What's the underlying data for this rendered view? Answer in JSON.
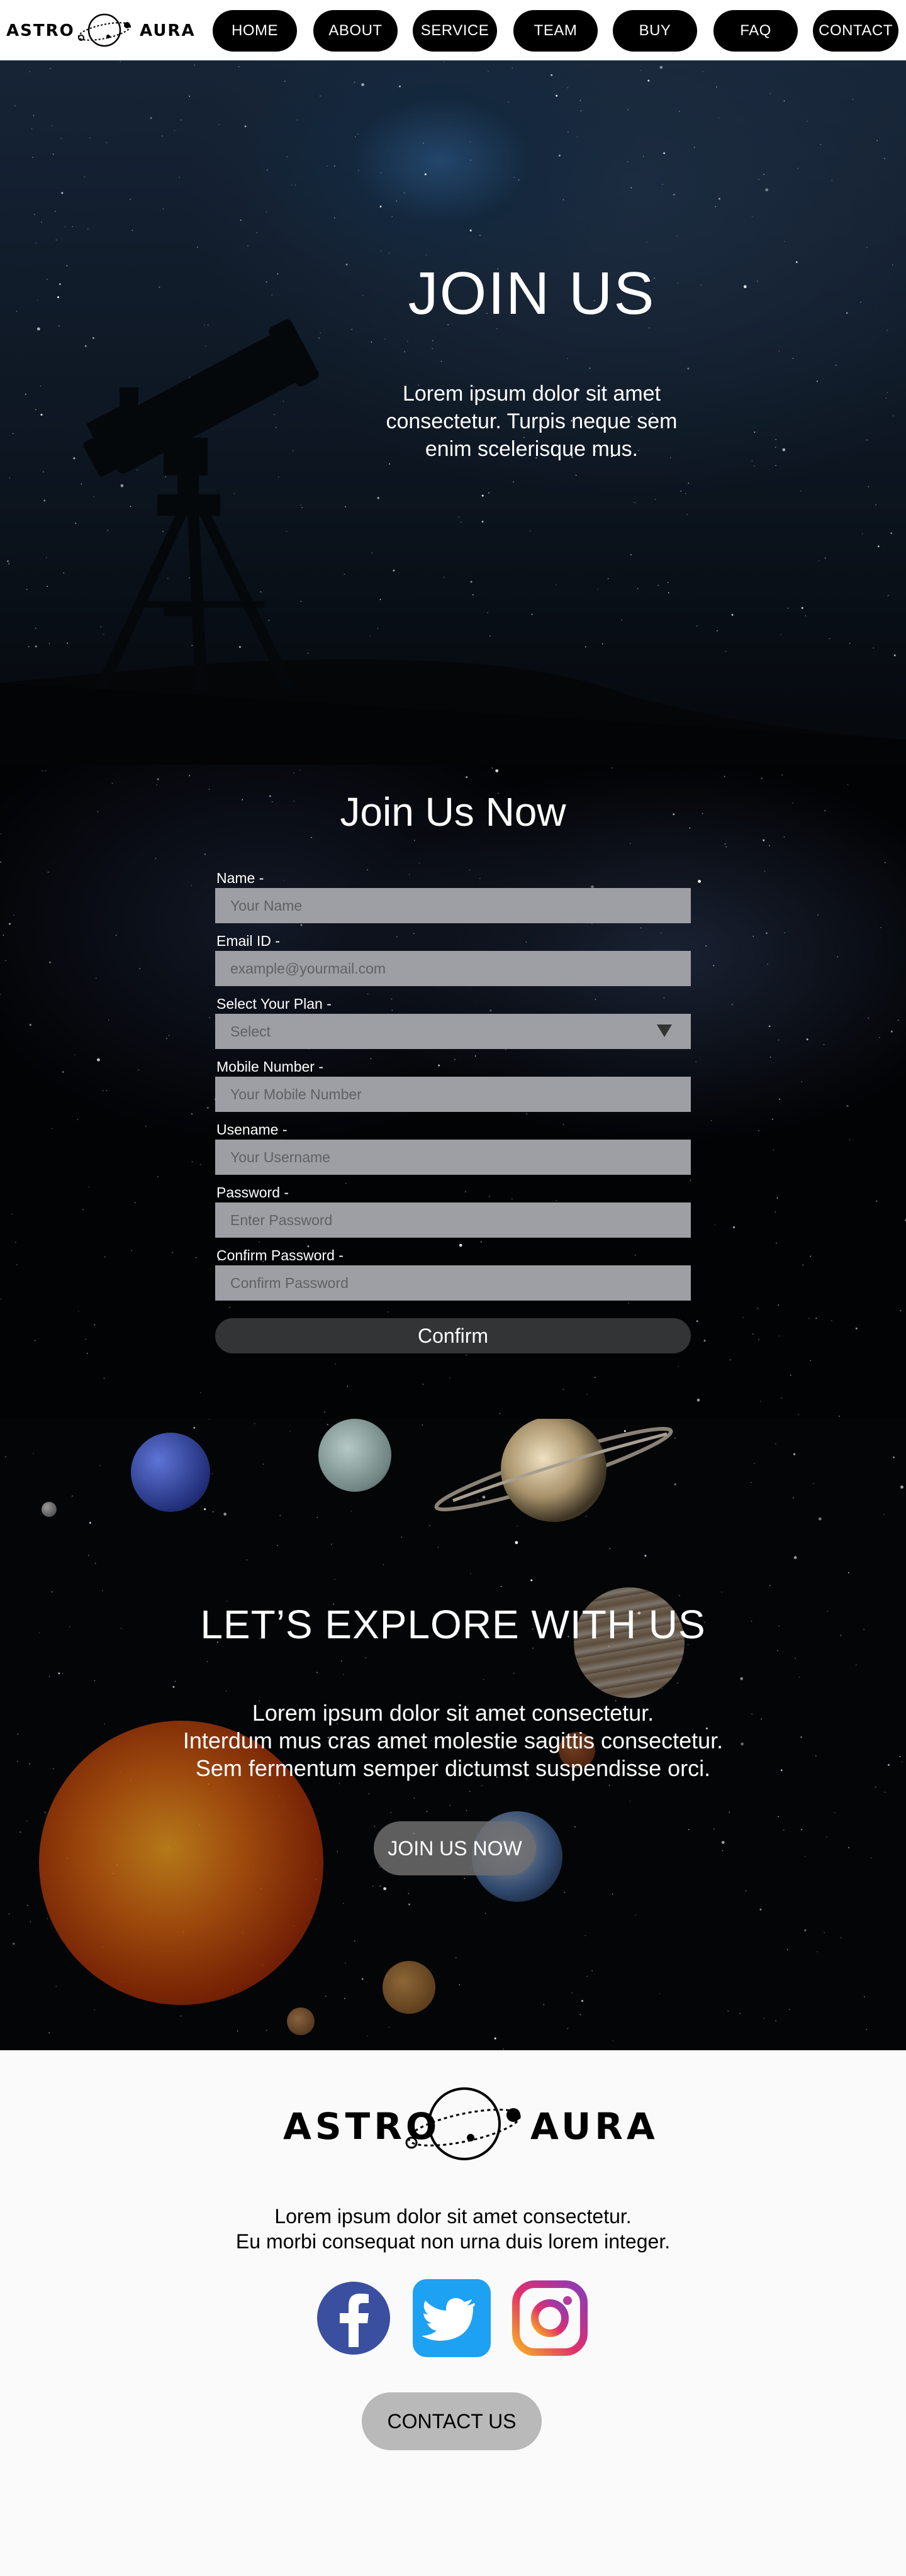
{
  "brand": {
    "left": "ASTRO",
    "right": "AURA",
    "logo_icon": "orbit-planet-icon"
  },
  "nav": {
    "items": [
      {
        "label": "HOME"
      },
      {
        "label": "ABOUT"
      },
      {
        "label": "SERVICE"
      },
      {
        "label": "TEAM"
      },
      {
        "label": "BUY"
      },
      {
        "label": "FAQ"
      },
      {
        "label": "CONTACT"
      }
    ]
  },
  "hero": {
    "title": "JOIN US",
    "text": "Lorem ipsum dolor sit amet consectetur. Turpis neque sem enim scelerisque mus."
  },
  "form": {
    "title": "Join Us Now",
    "fields": [
      {
        "label": "Name -",
        "placeholder": "Your Name"
      },
      {
        "label": "Email ID -",
        "placeholder": "example@yourmail.com"
      },
      {
        "label": "Select Your Plan -",
        "placeholder": "Select"
      },
      {
        "label": "Mobile Number -",
        "placeholder": "Your Mobile Number"
      },
      {
        "label": "Usename -",
        "placeholder": "Your Username"
      },
      {
        "label": "Password -",
        "placeholder": "Enter Password"
      },
      {
        "label": "Confirm Password -",
        "placeholder": "Confirm Password"
      }
    ],
    "submit_label": "Confirm"
  },
  "explore": {
    "title": "LET’S EXPLORE WITH US",
    "text_lines": [
      "Lorem ipsum dolor sit amet consectetur.",
      "Interdum mus cras amet molestie sagittis consectetur.",
      "Sem fermentum semper dictumst suspendisse orci."
    ],
    "button_label": "JOIN US NOW"
  },
  "footer": {
    "brand_left": "ASTRO",
    "brand_right": "AURA",
    "text_lines": [
      "Lorem ipsum dolor sit amet consectetur.",
      "Eu morbi consequat non urna duis lorem integer."
    ],
    "social": [
      {
        "icon": "facebook-icon",
        "color": "#3b5998"
      },
      {
        "icon": "twitter-icon",
        "color": "#1da1f2"
      },
      {
        "icon": "instagram-icon",
        "color": "#e1306c"
      }
    ],
    "contact_label": "CONTACT US"
  },
  "colors": {
    "nav_bg": "#ffffff",
    "nav_button": "#000000",
    "input_bg": "#9d9fa4",
    "confirm_bg": "#333436",
    "footer_bg": "#fafafa",
    "contact_btn": "#b9b9b9"
  }
}
